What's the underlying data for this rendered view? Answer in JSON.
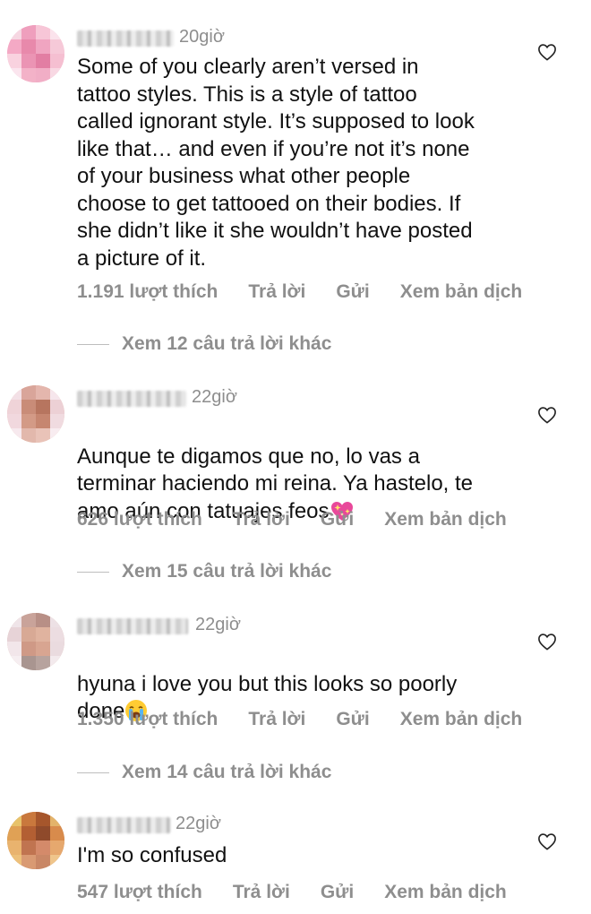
{
  "comments": [
    {
      "time": "20giờ",
      "text": "Some of you clearly aren’t versed in\ntattoo styles. This is a style of tattoo\ncalled ignorant style. It’s supposed to look\nlike that… and even if you’re not it’s none\nof your business what other people\nchoose to get tattooed on their bodies. If\nshe didn’t like it she wouldn’t have posted\na picture of it.",
      "likes": "1.191 lượt thích",
      "reply": "Trả lời",
      "send": "Gửi",
      "translate": "Xem bản dịch",
      "more_replies": "Xem 12 câu trả lời khác"
    },
    {
      "time": "22giờ",
      "text": "Aunque te digamos que no, lo vas a\nterminar haciendo mi reina. Ya hastelo, te\namo aún con tatuajes feos",
      "emoji": "sparkling-heart",
      "likes": "626 lượt thích",
      "reply": "Trả lời",
      "send": "Gửi",
      "translate": "Xem bản dịch",
      "more_replies": "Xem 15 câu trả lời khác"
    },
    {
      "time": "22giờ",
      "text": "hyuna i love you but this looks so poorly\ndone",
      "emoji": "loudly-crying-face",
      "likes": "1.350 lượt thích",
      "reply": "Trả lời",
      "send": "Gửi",
      "translate": "Xem bản dịch",
      "more_replies": "Xem 14 câu trả lời khác"
    },
    {
      "time": "22giờ",
      "text": "I'm so confused",
      "likes": "547 lượt thích",
      "reply": "Trả lời",
      "send": "Gửi",
      "translate": "Xem bản dịch"
    }
  ],
  "colors": {
    "text": "#111111",
    "meta": "#8e8e8e",
    "background": "#ffffff"
  },
  "icons": [
    "heart-outline-icon",
    "sparkling-heart-emoji",
    "loudly-crying-face-emoji"
  ]
}
